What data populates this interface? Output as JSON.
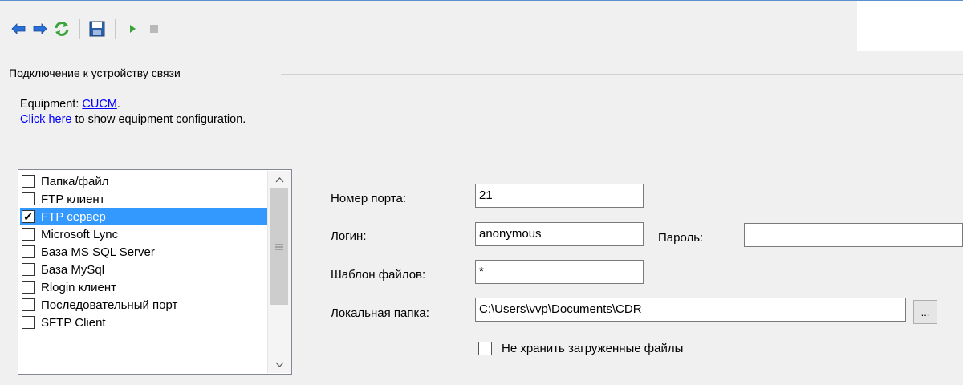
{
  "toolbar": {
    "buttons": [
      {
        "icon": "arrow-left-icon"
      },
      {
        "icon": "arrow-right-icon"
      },
      {
        "icon": "refresh-icon"
      },
      {
        "icon": "save-icon"
      },
      {
        "icon": "play-icon"
      },
      {
        "icon": "stop-icon"
      }
    ]
  },
  "group": {
    "title": "Подключение к устройству связи"
  },
  "equipment": {
    "prefix": "Equipment: ",
    "name": "CUCM",
    "suffix": ".",
    "click_link": "Click here",
    "click_text": " to show equipment configuration."
  },
  "connection_list": {
    "items": [
      {
        "label": "Папка/файл",
        "checked": false,
        "selected": false
      },
      {
        "label": "FTP клиент",
        "checked": false,
        "selected": false
      },
      {
        "label": "FTP сервер",
        "checked": true,
        "selected": true
      },
      {
        "label": "Microsoft Lync",
        "checked": false,
        "selected": false
      },
      {
        "label": "База MS SQL Server",
        "checked": false,
        "selected": false
      },
      {
        "label": "База MySql",
        "checked": false,
        "selected": false
      },
      {
        "label": "Rlogin клиент",
        "checked": false,
        "selected": false
      },
      {
        "label": "Последовательный порт",
        "checked": false,
        "selected": false
      },
      {
        "label": "SFTP Client",
        "checked": false,
        "selected": false
      }
    ]
  },
  "form": {
    "port_label": "Номер порта:",
    "port_value": "21",
    "login_label": "Логин:",
    "login_value": "anonymous",
    "password_label": "Пароль:",
    "password_value": "",
    "pattern_label": "Шаблон файлов:",
    "pattern_value": "*",
    "folder_label": "Локальная папка:",
    "folder_value": "C:\\Users\\vvp\\Documents\\CDR",
    "browse_label": "...",
    "nokeep_label": "Не хранить загруженные файлы",
    "nokeep_checked": false
  },
  "colors": {
    "selection": "#3399ff",
    "link": "#0000ff"
  }
}
